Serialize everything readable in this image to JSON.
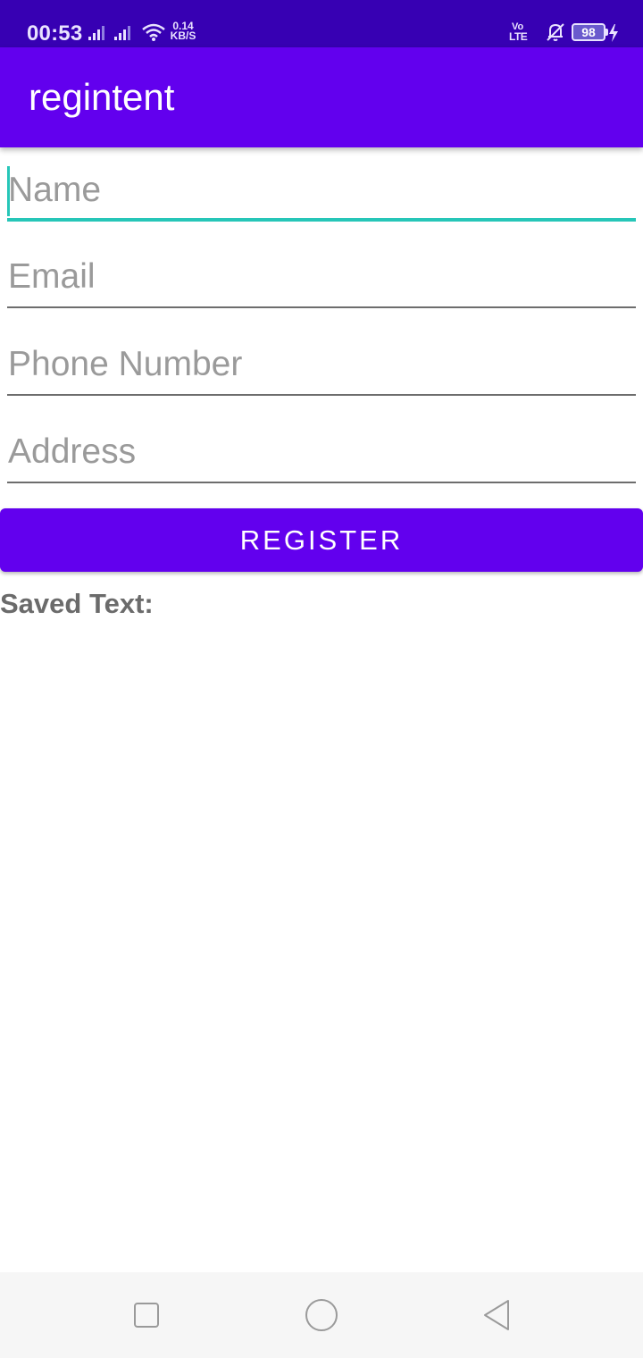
{
  "status_bar": {
    "time": "00:53",
    "net_speed_value": "0.14",
    "net_speed_unit": "KB/S",
    "volte_top": "Vo",
    "volte_bottom": "LTE",
    "battery_level": "98",
    "icons": [
      "signal-icon",
      "signal-icon",
      "wifi-icon",
      "volte-icon",
      "bell-off-icon",
      "battery-icon",
      "charging-icon"
    ]
  },
  "app_bar": {
    "title": "regintent"
  },
  "form": {
    "fields": [
      {
        "placeholder": "Name",
        "value": ""
      },
      {
        "placeholder": "Email",
        "value": ""
      },
      {
        "placeholder": "Phone Number",
        "value": ""
      },
      {
        "placeholder": "Address",
        "value": ""
      }
    ],
    "register_label": "REGISTER",
    "saved_text_label": "Saved Text:"
  },
  "nav_bar": {
    "buttons": [
      "recent-apps-icon",
      "home-icon",
      "back-icon"
    ]
  },
  "colors": {
    "status_bar": "#3700b3",
    "primary": "#6200ee",
    "accent": "#26c6b8",
    "saved_text": "#6b6b6b"
  }
}
